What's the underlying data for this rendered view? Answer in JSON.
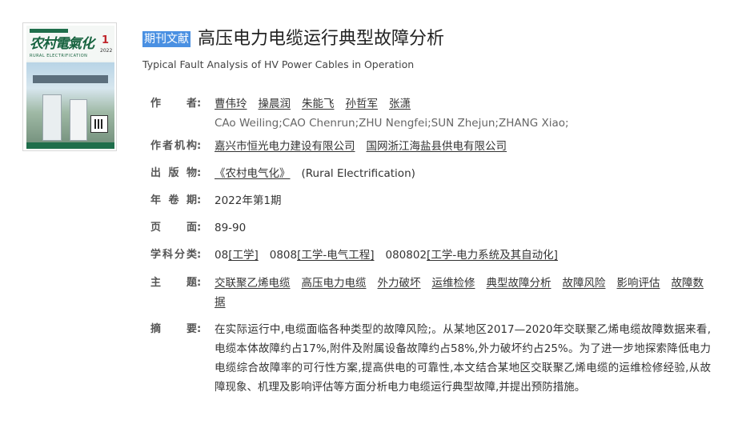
{
  "cover": {
    "masthead": "农村電氣化",
    "subtitle": "RURAL ELECTRIFICATION",
    "issue": "1",
    "year": "2022"
  },
  "article": {
    "tag": "期刊文献",
    "title": "高压电力电缆运行典型故障分析",
    "en_title": "Typical Fault Analysis of HV Power Cables in Operation"
  },
  "fields": {
    "authors": {
      "label": "作者",
      "names": [
        "曹伟玲",
        "操晨润",
        "朱能飞",
        "孙哲军",
        "张潇"
      ],
      "en_names": "CAo Weiling;CAO Chenrun;ZHU Nengfei;SUN Zhejun;ZHANG Xiao;"
    },
    "affiliation": {
      "label": "作者机构",
      "items": [
        "嘉兴市恒光电力建设有限公司",
        "国网浙江海盐县供电有限公司"
      ]
    },
    "publication": {
      "label": "出版物",
      "journal": "《农村电气化》",
      "journal_en": "(Rural Electrification)"
    },
    "volume": {
      "label": "年卷期",
      "value": "2022年第1期"
    },
    "pages": {
      "label": "页面",
      "value": "89-90"
    },
    "classification": {
      "label": "学科分类",
      "items": [
        {
          "code": "08",
          "name": "[工学]"
        },
        {
          "code": "0808",
          "name": "[工学-电气工程]"
        },
        {
          "code": "080802",
          "name": "[工学-电力系统及其自动化]"
        }
      ]
    },
    "keywords": {
      "label": "主题",
      "items": [
        "交联聚乙烯电缆",
        "高压电力电缆",
        "外力破坏",
        "运维检修",
        "典型故障分析",
        "故障风险",
        "影响评估",
        "故障数据"
      ]
    },
    "abstract": {
      "label": "摘要",
      "text": "在实际运行中,电缆面临各种类型的故障风险;。从某地区2017—2020年交联聚乙烯电缆故障数据来看,电缆本体故障约占17%,附件及附属设备故障约占58%,外力破坏约占25%。为了进一步地探索降低电力电缆综合故障率的可行性方案,提高供电的可靠性,本文结合某地区交联聚乙烯电缆的运维检修经验,从故障现象、机理及影响评估等方面分析电力电缆运行典型故障,并提出预防措施。"
    }
  }
}
